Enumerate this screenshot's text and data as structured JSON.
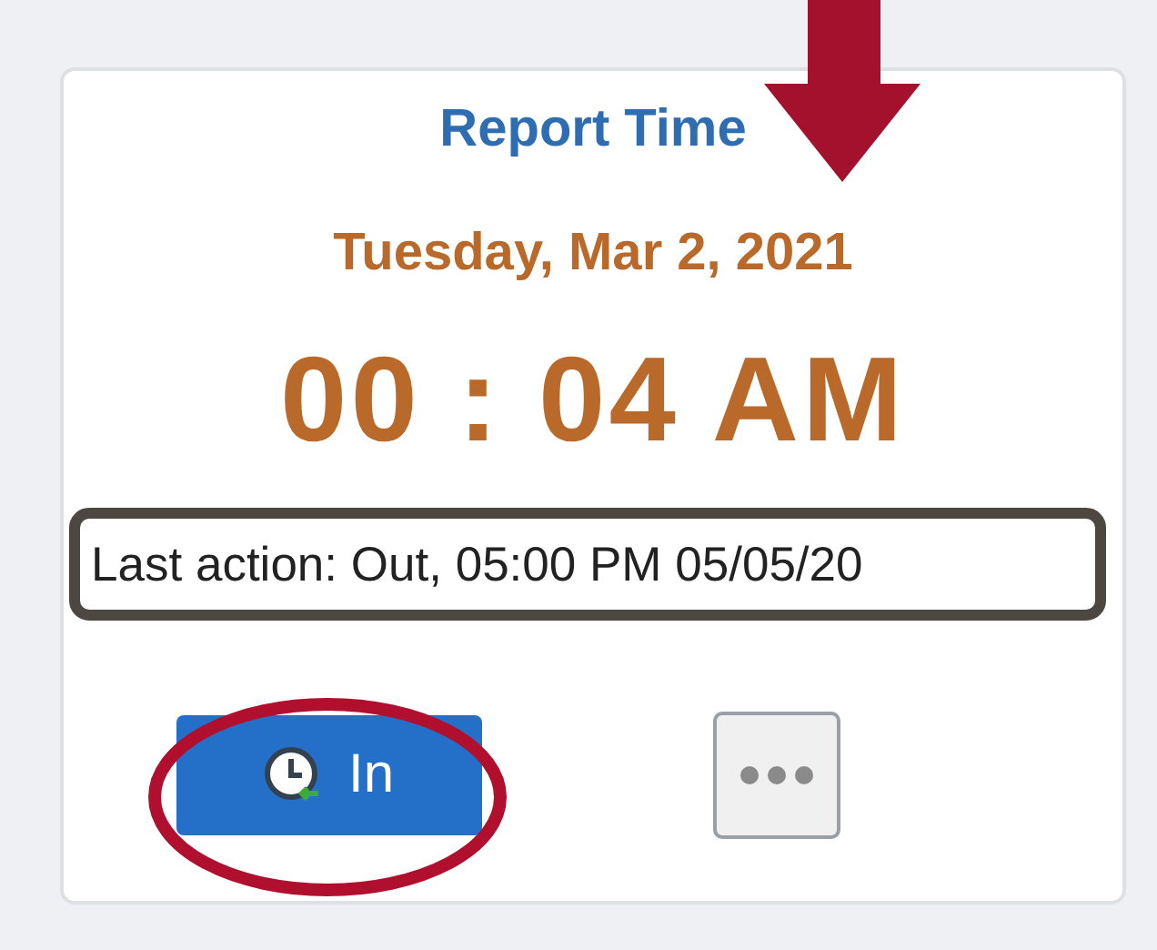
{
  "card": {
    "title": "Report Time",
    "date": "Tuesday, Mar 2, 2021",
    "time": "00 : 04 AM",
    "last_action": "Last action: Out, 05:00 PM 05/05/20"
  },
  "buttons": [
    {
      "kind": "punch",
      "label": "In"
    },
    {
      "kind": "more"
    }
  ]
}
